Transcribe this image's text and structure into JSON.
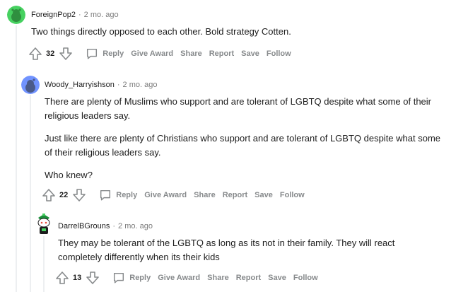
{
  "comments": [
    {
      "username": "ForeignPop2",
      "time": "2 mo. ago",
      "paragraphs": [
        "Two things directly opposed to each other. Bold strategy Cotten."
      ],
      "score": "32"
    },
    {
      "username": "Woody_Harryishson",
      "time": "2 mo. ago",
      "paragraphs": [
        "There are plenty of Muslims who support and are tolerant of LGBTQ despite what some of their religious leaders say.",
        "Just like there are plenty of Christians who support and are tolerant of LGBTQ despite what some of their religious leaders say.",
        "Who knew?"
      ],
      "score": "22"
    },
    {
      "username": "DarrelBGrouns",
      "time": "2 mo. ago",
      "paragraphs": [
        "They may be tolerant of the LGBTQ as long as its not in their family. They will react completely differently when its their kids"
      ],
      "score": "13"
    }
  ],
  "separator": "·",
  "actions": {
    "reply": "Reply",
    "give_award": "Give Award",
    "share": "Share",
    "report": "Report",
    "save": "Save",
    "follow": "Follow"
  },
  "icons": {
    "upvote": "upvote-arrow-icon",
    "downvote": "downvote-arrow-icon",
    "reply": "speech-bubble-icon"
  },
  "colors": {
    "text": "#1c1c1c",
    "meta": "#7c7c7c",
    "action": "#878a8c",
    "thread_line": "#edeff1",
    "avatar_green": "#46d160",
    "avatar_blue": "#7193ff"
  }
}
